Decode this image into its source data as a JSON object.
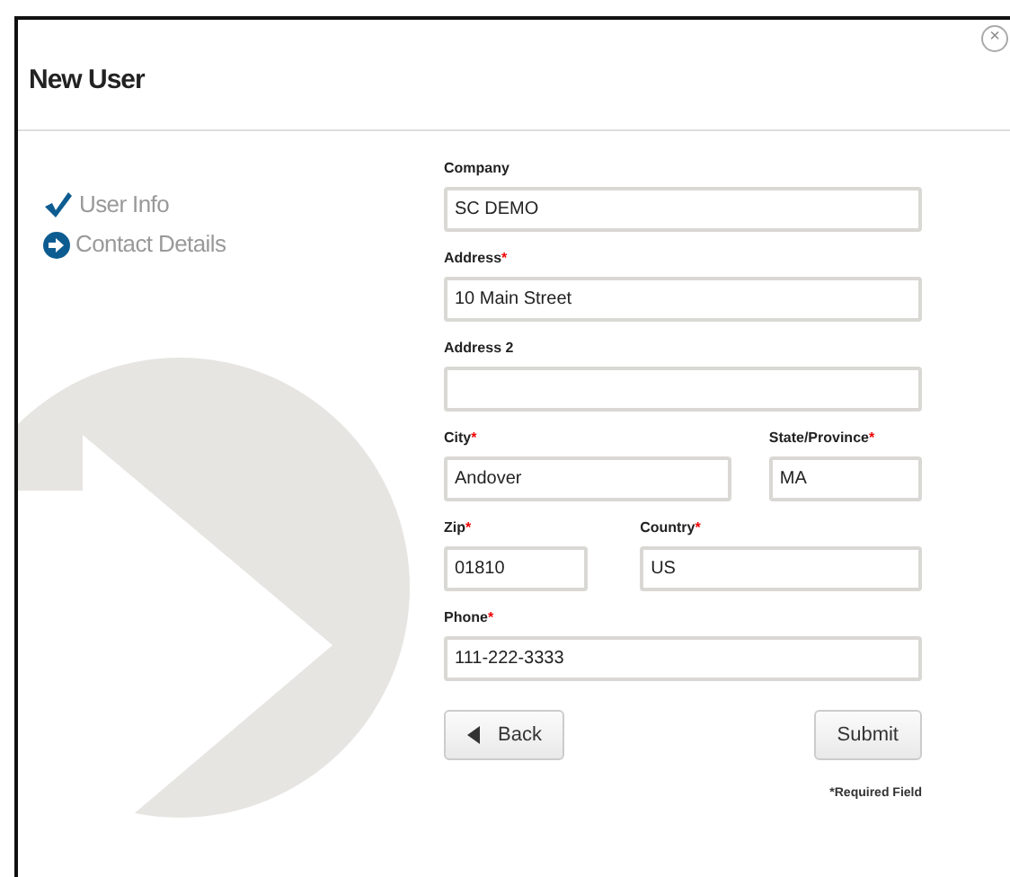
{
  "dialog": {
    "title": "New User",
    "close_label": "×"
  },
  "steps": [
    {
      "label": "User Info",
      "completed": true
    },
    {
      "label": "Contact Details",
      "completed": false
    }
  ],
  "form": {
    "rows": [
      [
        {
          "label": "Company",
          "value": "SC DEMO",
          "required": false
        }
      ],
      [
        {
          "label": "Address",
          "value": "10 Main Street",
          "required": true
        }
      ],
      [
        {
          "label": "Address 2",
          "required": false
        }
      ],
      [
        {
          "label": "City",
          "value": "Andover",
          "required": true
        },
        {
          "label": "State/Province",
          "value": "MA",
          "required": true
        }
      ],
      [
        {
          "label": "Zip",
          "value": "01810",
          "required": true
        },
        {
          "label": "Country",
          "value": "US",
          "required": true
        }
      ],
      [
        {
          "label": "Phone",
          "value": "111-222-3333",
          "required": true
        }
      ]
    ],
    "required_mark": "*",
    "back_button": "Back",
    "submit_button": "Submit",
    "required_note": "*Required Field"
  }
}
